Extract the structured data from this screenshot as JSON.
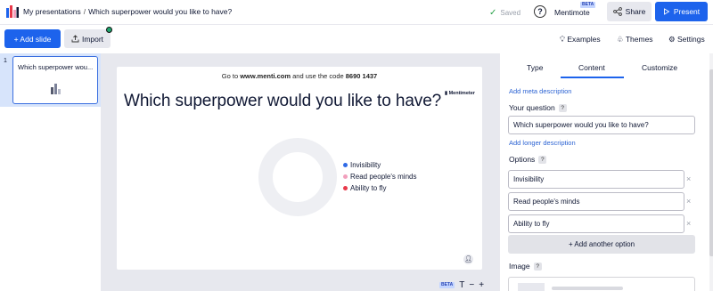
{
  "header": {
    "breadcrumb_root": "My presentations",
    "breadcrumb_separator": "/",
    "presentation_title": "Which superpower would you like to have?",
    "saved_label": "Saved",
    "help_label": "?",
    "mentimote_label": "Mentimote",
    "mentimote_badge": "BETA",
    "share_label": "Share",
    "present_label": "Present"
  },
  "toolbar": {
    "add_slide_label": "+ Add slide",
    "import_label": "Import",
    "examples_label": "Examples",
    "themes_label": "Themes",
    "settings_label": "Settings"
  },
  "slides": [
    {
      "number": "1",
      "title": "Which superpower wou..."
    }
  ],
  "slide": {
    "join_prefix": "Go to ",
    "join_url": "www.menti.com",
    "join_mid": " and use the code ",
    "join_code": "8690 1437",
    "title": "Which superpower would you like to have?",
    "brand": "Mentimeter",
    "legend": [
      {
        "label": "Invisibility",
        "color": "#2f6ae6"
      },
      {
        "label": "Read people's minds",
        "color": "#f2a0bd"
      },
      {
        "label": "Ability to fly",
        "color": "#e8394a"
      }
    ]
  },
  "canvas_tools": {
    "badge": "BETA",
    "text_icon": "T",
    "zoom_out": "−",
    "zoom_in": "+"
  },
  "panel": {
    "tabs": [
      "Type",
      "Content",
      "Customize"
    ],
    "active_tab": "Content",
    "add_meta_description": "Add meta description",
    "your_question_label": "Your question",
    "question_value": "Which superpower would you like to have?",
    "add_longer_description": "Add longer description",
    "options_label": "Options",
    "options": [
      "Invisibility",
      "Read people's minds",
      "Ability to fly"
    ],
    "add_option_label": "+ Add another option",
    "image_label": "Image",
    "help_glyph": "?",
    "remove_glyph": "×"
  },
  "colors": {
    "accent": "#1d63ec",
    "link": "#2c63d3",
    "canvas_bg": "#e7e8ee",
    "selected_slide_bg": "#d7e4fb"
  }
}
